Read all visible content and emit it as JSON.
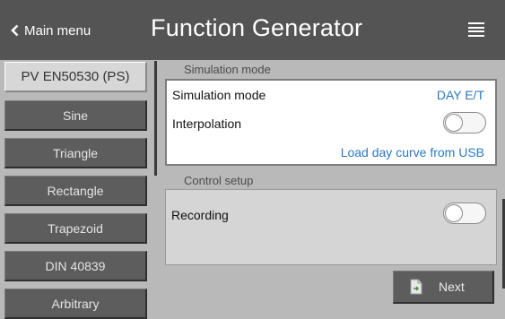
{
  "header": {
    "back_label": "Main menu",
    "title": "Function Generator",
    "menu_icon": "hamburger-icon",
    "back_icon": "chevron-left-icon"
  },
  "sidebar": {
    "items": [
      {
        "label": "PV EN50530 (PS)",
        "active": true
      },
      {
        "label": "Sine",
        "active": false
      },
      {
        "label": "Triangle",
        "active": false
      },
      {
        "label": "Rectangle",
        "active": false
      },
      {
        "label": "Trapezoid",
        "active": false
      },
      {
        "label": "DIN 40839",
        "active": false
      },
      {
        "label": "Arbitrary",
        "active": false
      }
    ]
  },
  "simulation": {
    "section_title": "Simulation mode",
    "mode_label": "Simulation mode",
    "mode_value": "DAY E/T",
    "interpolation_label": "Interpolation",
    "interpolation_on": false,
    "load_link": "Load day curve from USB"
  },
  "control": {
    "section_title": "Control setup",
    "recording_label": "Recording",
    "recording_on": false
  },
  "footer": {
    "next_label": "Next",
    "next_icon": "document-next-icon"
  },
  "colors": {
    "header_bg": "#545454",
    "page_bg": "#b9b9b9",
    "button_bg": "#5d5d5d",
    "active_item_bg": "#d7d7d7",
    "link_blue": "#2a79c4"
  }
}
